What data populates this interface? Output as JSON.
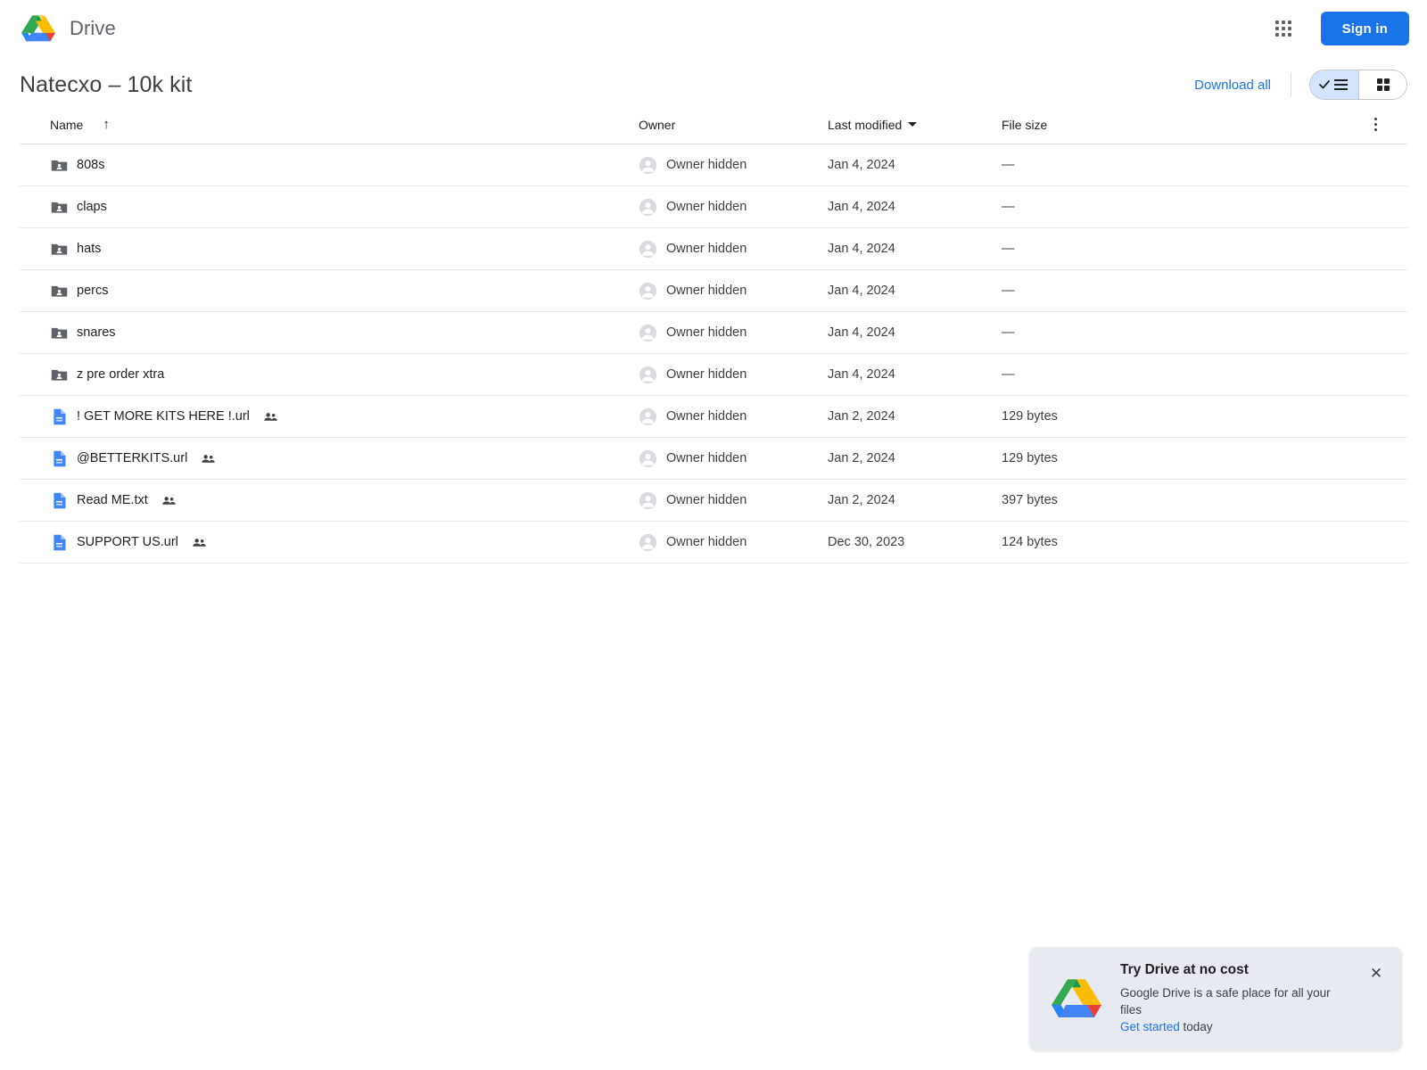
{
  "header": {
    "brand_name": "Drive",
    "logo_icon": "drive-logo",
    "apps_icon": "apps-grid-icon",
    "signin_label": "Sign in"
  },
  "title_row": {
    "folder_title": "Natecxo – 10k kit",
    "download_all_label": "Download all",
    "list_view_icon": "list-view-icon",
    "grid_view_icon": "grid-view-icon",
    "active_view": "list"
  },
  "table": {
    "columns": {
      "name": "Name",
      "owner": "Owner",
      "last_modified": "Last modified",
      "file_size": "File size"
    },
    "sort_arrow_icon": "sort-ascending-arrow-icon",
    "sort_caret_icon": "chevron-down-icon",
    "more_icon": "more-vertical-icon",
    "rows": [
      {
        "name": "808s",
        "icon": "shared-folder-icon",
        "shared": false,
        "owner": "Owner hidden",
        "modified": "Jan 4, 2024",
        "size": "—"
      },
      {
        "name": "claps",
        "icon": "shared-folder-icon",
        "shared": false,
        "owner": "Owner hidden",
        "modified": "Jan 4, 2024",
        "size": "—"
      },
      {
        "name": "hats",
        "icon": "shared-folder-icon",
        "shared": false,
        "owner": "Owner hidden",
        "modified": "Jan 4, 2024",
        "size": "—"
      },
      {
        "name": "percs",
        "icon": "shared-folder-icon",
        "shared": false,
        "owner": "Owner hidden",
        "modified": "Jan 4, 2024",
        "size": "—"
      },
      {
        "name": "snares",
        "icon": "shared-folder-icon",
        "shared": false,
        "owner": "Owner hidden",
        "modified": "Jan 4, 2024",
        "size": "—"
      },
      {
        "name": "z pre order xtra",
        "icon": "shared-folder-icon",
        "shared": false,
        "owner": "Owner hidden",
        "modified": "Jan 4, 2024",
        "size": "—"
      },
      {
        "name": "! GET MORE KITS HERE !.url",
        "icon": "document-file-icon",
        "shared": true,
        "owner": "Owner hidden",
        "modified": "Jan 2, 2024",
        "size": "129 bytes"
      },
      {
        "name": "@BETTERKITS.url",
        "icon": "document-file-icon",
        "shared": true,
        "owner": "Owner hidden",
        "modified": "Jan 2, 2024",
        "size": "129 bytes"
      },
      {
        "name": "Read ME.txt",
        "icon": "document-file-icon",
        "shared": true,
        "owner": "Owner hidden",
        "modified": "Jan 2, 2024",
        "size": "397 bytes"
      },
      {
        "name": "SUPPORT US.url",
        "icon": "document-file-icon",
        "shared": true,
        "owner": "Owner hidden",
        "modified": "Dec 30, 2023",
        "size": "124 bytes"
      }
    ]
  },
  "promo": {
    "title": "Try Drive at no cost",
    "body_line": "Google Drive is a safe place for all your files",
    "link_label": "Get started",
    "link_suffix": " today",
    "close_icon": "close-icon",
    "logo_icon": "drive-logo"
  },
  "colors": {
    "accent_blue": "#1a73e8",
    "active_segment": "#d3e3fd",
    "promo_bg": "#e8eaf2",
    "folder_gray": "#5f6368",
    "file_blue": "#4285f4"
  }
}
